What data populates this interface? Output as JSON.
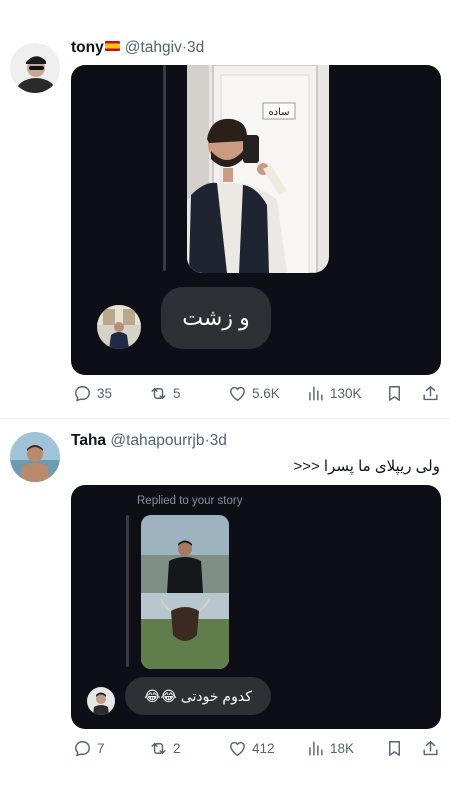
{
  "tweets": [
    {
      "name": "tony",
      "handle": "@tahgiv",
      "dot": "·",
      "time": "3d",
      "story_sign": "ساده",
      "reply_text": "و زشت",
      "stats": {
        "replies": "35",
        "retweets": "5",
        "likes": "5.6K",
        "views": "130K"
      }
    },
    {
      "name": "Taha",
      "handle": "@tahapourrjb",
      "dot": "·",
      "time": "3d",
      "text": "ولی ریپلای ما پسرا <<<",
      "replied_label": "Replied to your story",
      "reply_text": "کدوم خودتی",
      "reply_emoji": "😂😂",
      "stats": {
        "replies": "7",
        "retweets": "2",
        "likes": "412",
        "views": "18K"
      }
    }
  ],
  "colors": {
    "media_bg": "#0e0f16",
    "bubble_bg": "#2f3036",
    "icon_gray": "#536471"
  },
  "icons": [
    "reply-icon",
    "retweet-icon",
    "like-icon",
    "views-icon",
    "bookmark-icon",
    "share-icon",
    "spain-flag-icon"
  ]
}
